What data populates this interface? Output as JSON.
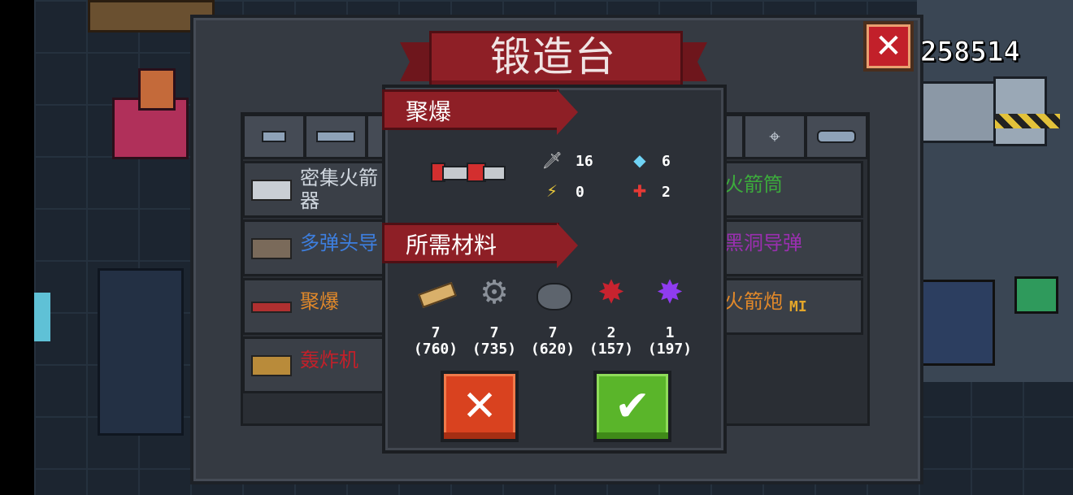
{
  "window": {
    "title": "锻造台",
    "gem_count": "258514",
    "close_label": "✕"
  },
  "tabs": [
    {
      "icon": "pistol-icon"
    },
    {
      "icon": "rifle-icon"
    },
    {
      "icon": "shotgun-icon"
    },
    {
      "icon": "bow-icon"
    },
    {
      "icon": "crosshair-icon"
    },
    {
      "icon": "fish-gun-icon"
    }
  ],
  "weapons_left": [
    {
      "name_line1": "密集火箭",
      "name_line2": "器",
      "color": "#cfd6de",
      "icon": "dense-rocket-icon"
    },
    {
      "name_line1": "多弹头导",
      "name_line2": "",
      "color": "#3d7fe0",
      "icon": "multi-warhead-icon"
    },
    {
      "name_line1": "聚爆",
      "name_line2": "",
      "color": "#e0882a",
      "icon": "implosion-icon"
    },
    {
      "name_line1": "轰炸机",
      "name_line2": "",
      "color": "#c2202a",
      "icon": "bomber-icon"
    }
  ],
  "weapons_right": [
    {
      "name": "火箭筒",
      "badge": "",
      "color": "#3cab3c"
    },
    {
      "name": "黑洞导弹",
      "badge": "",
      "color": "#9b2fb0"
    },
    {
      "name": "火箭炮",
      "badge": "MI",
      "color": "#e0882a"
    }
  ],
  "popup": {
    "weapon_name": "聚爆",
    "stats": {
      "damage": "16",
      "energy": "6",
      "crit": "0",
      "spread": "2"
    },
    "materials_title": "所需材料",
    "materials": [
      {
        "icon": "wood-plank-icon",
        "need": "7",
        "have": "(760)"
      },
      {
        "icon": "gear-icon",
        "need": "7",
        "have": "(735)"
      },
      {
        "icon": "iron-ore-icon",
        "need": "7",
        "have": "(620)"
      },
      {
        "icon": "red-crystal-icon",
        "need": "2",
        "have": "(157)"
      },
      {
        "icon": "purple-crystal-icon",
        "need": "1",
        "have": "(197)"
      }
    ],
    "cancel_label": "✕",
    "confirm_label": "✔"
  },
  "colors": {
    "accent_red": "#8e1f26",
    "cancel": "#d9421f",
    "confirm": "#5ab52a"
  }
}
